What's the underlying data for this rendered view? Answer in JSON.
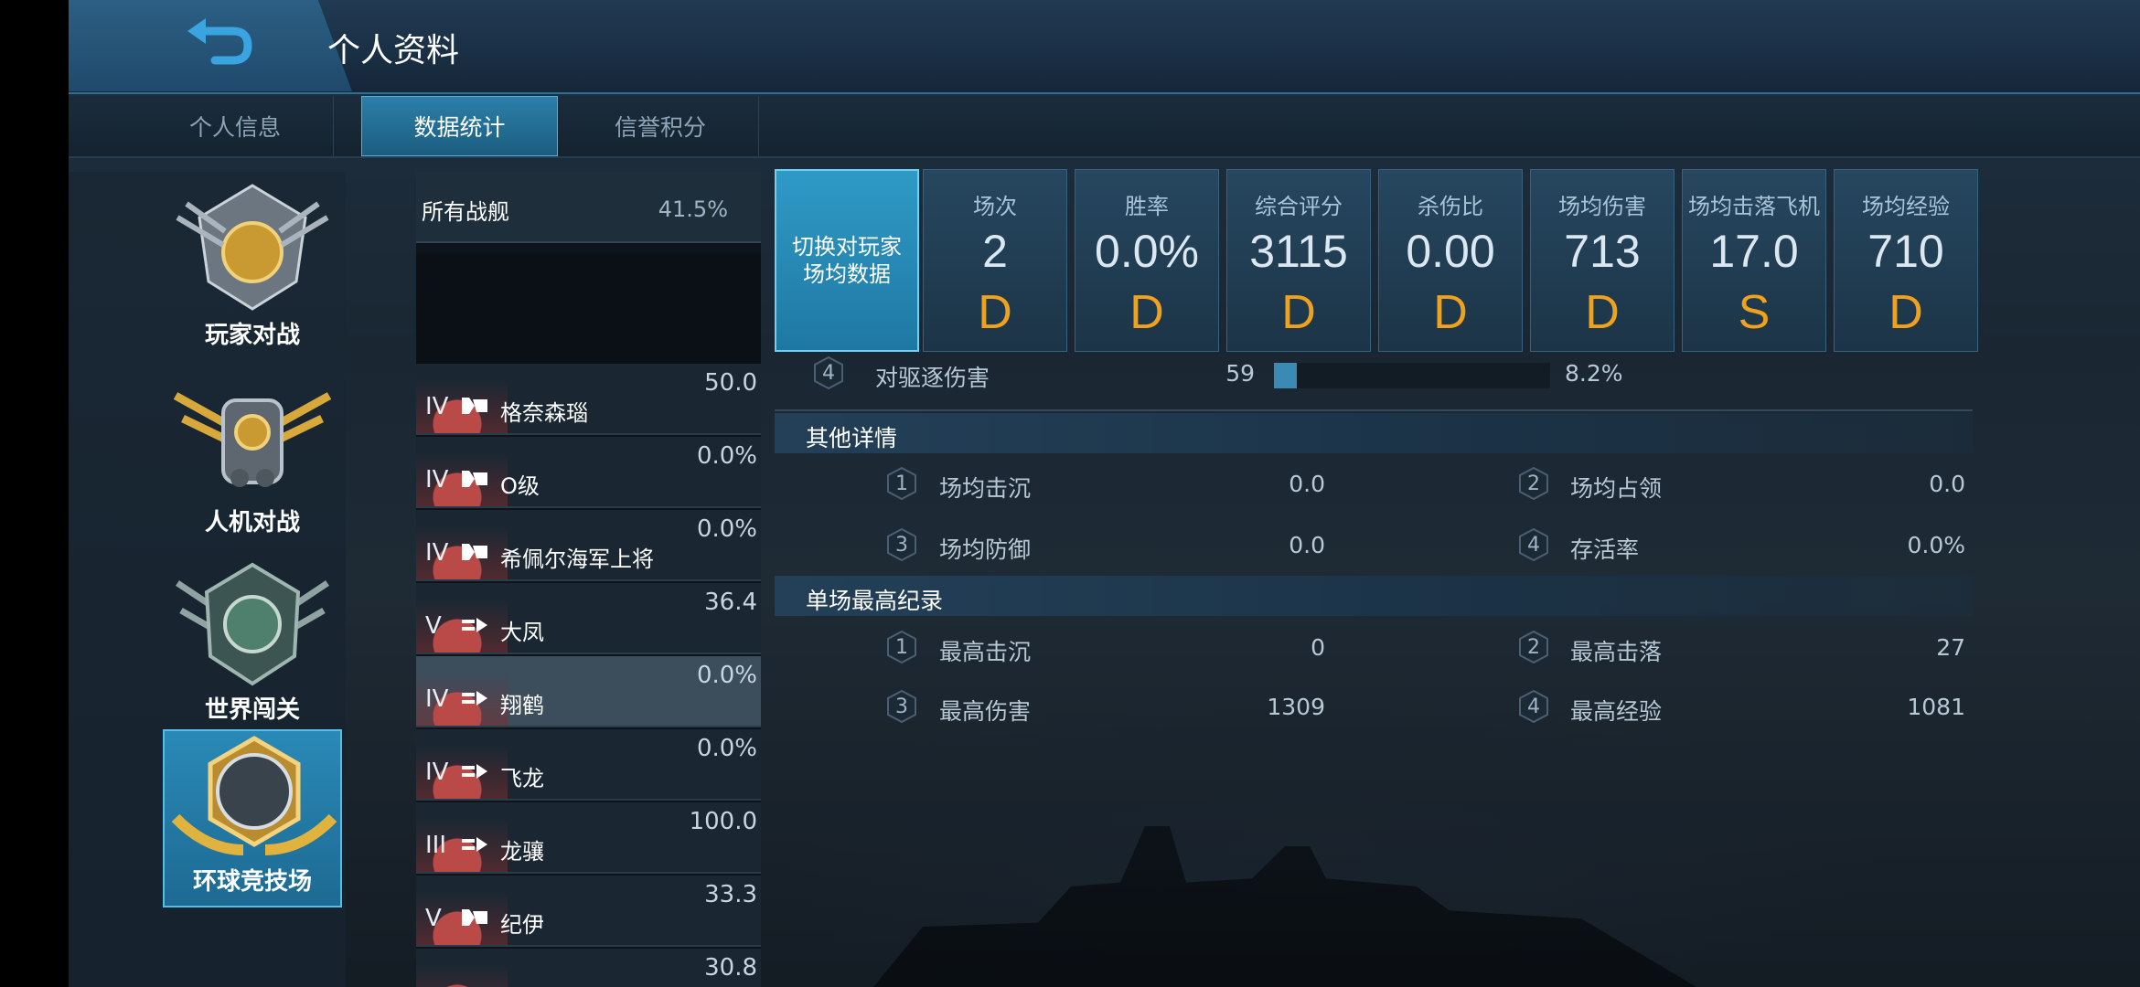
{
  "header": {
    "title": "个人资料"
  },
  "tabs": [
    {
      "label": "个人信息"
    },
    {
      "label": "数据统计"
    },
    {
      "label": "信誉积分"
    }
  ],
  "modes": [
    {
      "label": "玩家对战"
    },
    {
      "label": "人机对战"
    },
    {
      "label": "世界闯关"
    },
    {
      "label": "环球竞技场"
    }
  ],
  "ship_list": {
    "all": {
      "label": "所有战舰",
      "value": "41.5%"
    },
    "ships": [
      {
        "tier": "IV",
        "name": "格奈森瑙",
        "value": "50.0"
      },
      {
        "tier": "IV",
        "name": "O级",
        "value": "0.0%"
      },
      {
        "tier": "IV",
        "name": "希佩尔海军上将",
        "value": "0.0%"
      },
      {
        "tier": "V",
        "name": "大凤",
        "value": "36.4"
      },
      {
        "tier": "IV",
        "name": "翔鹤",
        "value": "0.0%"
      },
      {
        "tier": "IV",
        "name": "飞龙",
        "value": "0.0%"
      },
      {
        "tier": "III",
        "name": "龙骧",
        "value": "100.0"
      },
      {
        "tier": "V",
        "name": "纪伊",
        "value": "33.3"
      },
      {
        "tier": "",
        "name": "",
        "value": "30.8"
      }
    ]
  },
  "switch_button": {
    "label": "切换对玩家场均数据"
  },
  "stats": [
    {
      "label": "场次",
      "value": "2",
      "grade": "D"
    },
    {
      "label": "胜率",
      "value": "0.0%",
      "grade": "D"
    },
    {
      "label": "综合评分",
      "value": "3115",
      "grade": "D"
    },
    {
      "label": "杀伤比",
      "value": "0.00",
      "grade": "D"
    },
    {
      "label": "场均伤害",
      "value": "713",
      "grade": "D"
    },
    {
      "label": "场均击落飞机",
      "value": "17.0",
      "grade": "S"
    },
    {
      "label": "场均经验",
      "value": "710",
      "grade": "D"
    }
  ],
  "damage_row": {
    "num": "4",
    "label": "对驱逐伤害",
    "value": "59",
    "percent": "8.2%",
    "fraction": 0.082
  },
  "other_details": {
    "title": "其他详情",
    "items": [
      {
        "num": "1",
        "label": "场均击沉",
        "value": "0.0"
      },
      {
        "num": "2",
        "label": "场均占领",
        "value": "0.0"
      },
      {
        "num": "3",
        "label": "场均防御",
        "value": "0.0"
      },
      {
        "num": "4",
        "label": "存活率",
        "value": "0.0%"
      }
    ]
  },
  "records": {
    "title": "单场最高纪录",
    "items": [
      {
        "num": "1",
        "label": "最高击沉",
        "value": "0"
      },
      {
        "num": "2",
        "label": "最高击落",
        "value": "27"
      },
      {
        "num": "3",
        "label": "最高伤害",
        "value": "1309"
      },
      {
        "num": "4",
        "label": "最高经验",
        "value": "1081"
      }
    ]
  },
  "colors": {
    "accent": "#2f9ac6",
    "grade": "#f0a21c",
    "bar": "#3a8ab3"
  },
  "icons": {
    "back": "back-arrow-icon",
    "ship_type": "ship-class-icon"
  }
}
